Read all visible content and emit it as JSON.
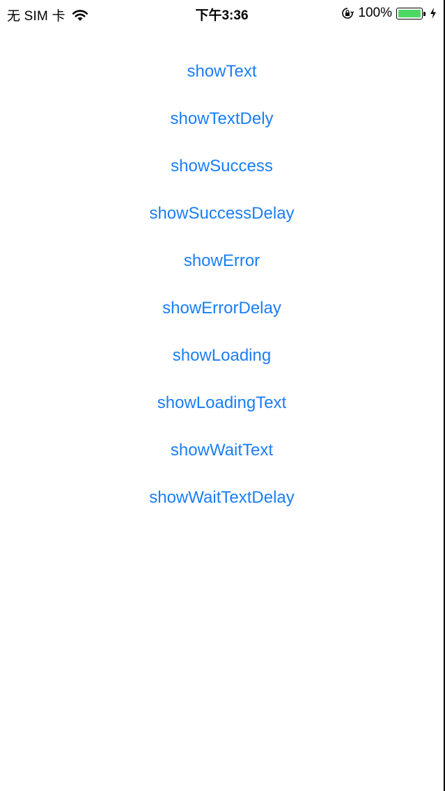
{
  "status_bar": {
    "carrier": "无 SIM 卡",
    "time": "下午3:36",
    "battery_percent": "100%",
    "battery_level": 1.0,
    "icons": [
      "wifi-icon",
      "rotation-lock-icon",
      "battery-icon",
      "charging-bolt-icon"
    ]
  },
  "colors": {
    "link": "#1a7ef5",
    "battery_fill": "#4cd964"
  },
  "menu": {
    "items": [
      {
        "label": "showText"
      },
      {
        "label": "showTextDely"
      },
      {
        "label": "showSuccess"
      },
      {
        "label": "showSuccessDelay"
      },
      {
        "label": "showError"
      },
      {
        "label": "showErrorDelay"
      },
      {
        "label": "showLoading"
      },
      {
        "label": "showLoadingText"
      },
      {
        "label": "showWaitText"
      },
      {
        "label": "showWaitTextDelay"
      }
    ]
  }
}
